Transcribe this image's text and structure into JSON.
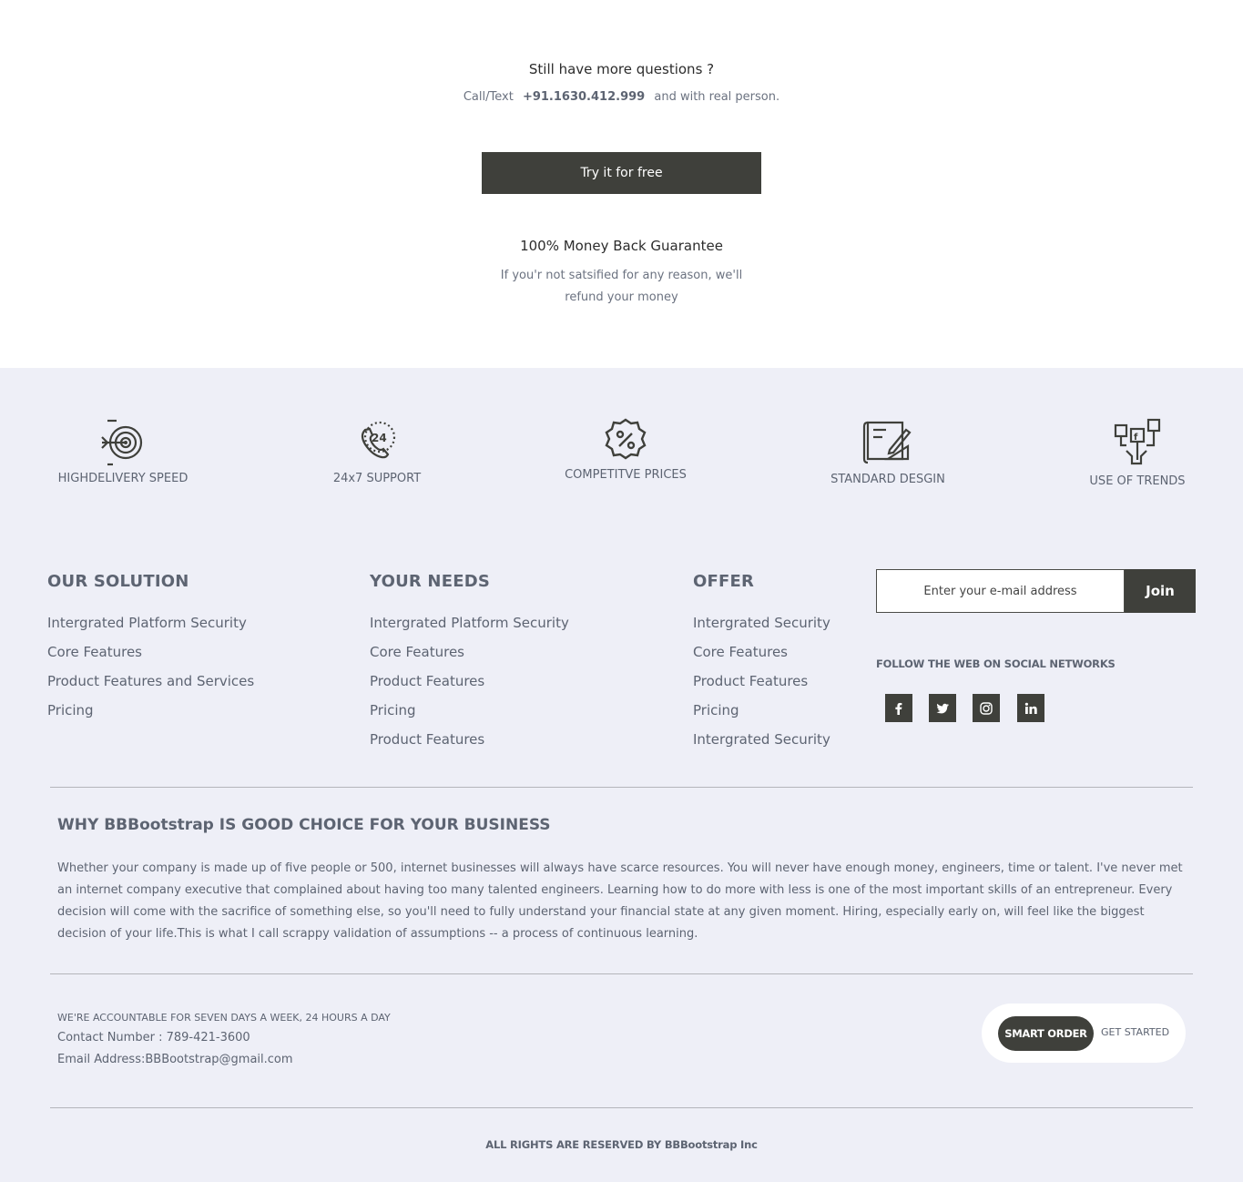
{
  "questions": {
    "title": "Still have more questions ?",
    "prefix": "Call/Text",
    "phone": "+91.1630.412.999",
    "suffix": "and with real person."
  },
  "cta": {
    "label": "Try it for free"
  },
  "guarantee": {
    "title": "100% Money Back Guarantee",
    "text": "If you'r not satsified for any reason, we'll refund your money"
  },
  "features": [
    {
      "label": "HIGHDELIVERY SPEED",
      "icon": "target-icon"
    },
    {
      "label": "24x7 SUPPORT",
      "icon": "phone-24-icon"
    },
    {
      "label": "COMPETITVE PRICES",
      "icon": "discount-badge-icon"
    },
    {
      "label": "STANDARD DESGIN",
      "icon": "blueprint-pencil-icon"
    },
    {
      "label": "USE OF TRENDS",
      "icon": "social-network-icon"
    }
  ],
  "columns": [
    {
      "title": "OUR SOLUTION",
      "links": [
        "Intergrated Platform Security",
        "Core Features",
        "Product Features and Services",
        "Pricing"
      ]
    },
    {
      "title": "YOUR NEEDS",
      "links": [
        "Intergrated Platform Security",
        "Core Features",
        "Product Features",
        "Pricing",
        "Product Features"
      ]
    },
    {
      "title": "OFFER",
      "links": [
        "Intergrated Security",
        "Core Features",
        "Product Features",
        "Pricing",
        "Intergrated Security"
      ]
    }
  ],
  "subscribe": {
    "placeholder": "Enter your e-mail address",
    "button": "Join"
  },
  "follow": "FOLLOW THE WEB ON SOCIAL NETWORKS",
  "social": [
    "facebook-icon",
    "twitter-icon",
    "instagram-icon",
    "linkedin-icon"
  ],
  "why": {
    "title": "WHY BBBootstrap IS GOOD CHOICE FOR YOUR BUSINESS",
    "text": "Whether your company is made up of five people or 500, internet businesses will always have scarce resources. You will never have enough money, engineers, time or talent. I've never met an internet company executive that complained about having too many talented engineers. Learning how to do more with less is one of the most important skills of an entrepreneur. Every decision will come with the sacrifice of something else, so you'll need to fully understand your financial state at any given moment. Hiring, especially early on, will feel like the biggest decision of your life.This is what I call scrappy validation of assumptions -- a process of continuous learning."
  },
  "contact": {
    "accountable": "WE'RE ACCOUNTABLE FOR SEVEN DAYS A WEEK, 24 HOURS A DAY",
    "number": "Contact Number : 789-421-3600",
    "email": "Email Address:BBBootstrap@gmail.com"
  },
  "order": {
    "smart": "SMART ORDER",
    "started": "GET STARTED"
  },
  "rights": "ALL RIGHTS ARE RESERVED BY BBBootstrap Inc",
  "colors": {
    "dark": "#3f403b",
    "footer_bg": "#eeeff7",
    "text": "#5d6472"
  }
}
